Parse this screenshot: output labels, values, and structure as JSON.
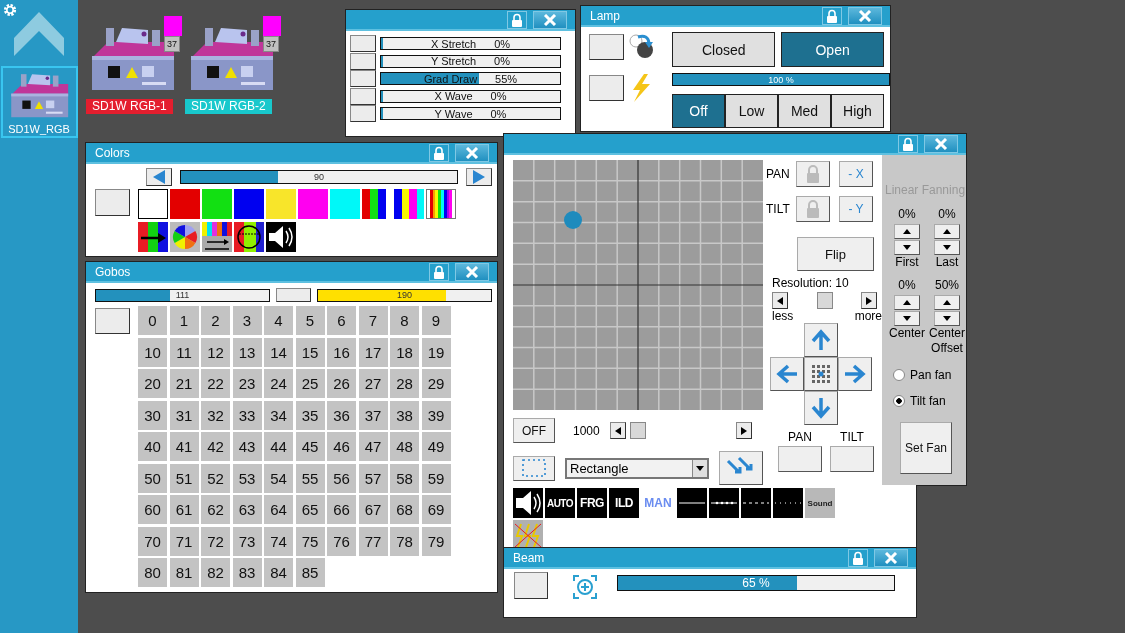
{
  "sidebar": {
    "device": {
      "label": "SD1W_RGB",
      "selected": true
    }
  },
  "fixtures": [
    {
      "label": "SD1W RGB-1",
      "color": "#e41e2e",
      "badge": "37"
    },
    {
      "label": "SD1W RGB-2",
      "color": "#18c8cc",
      "badge": "37"
    }
  ],
  "effects_window": {
    "sliders": [
      {
        "label": "X Stretch",
        "reading": "0%",
        "level": 0
      },
      {
        "label": "Y Stretch",
        "reading": "0%",
        "level": 0
      },
      {
        "label": "Grad Draw",
        "reading": "55%",
        "level": 0.55
      },
      {
        "label": "X Wave",
        "reading": "0%",
        "level": 0
      },
      {
        "label": "Y Wave",
        "reading": "0%",
        "level": 0
      }
    ]
  },
  "lamp_window": {
    "title": "Lamp",
    "shutter": [
      {
        "label": "Closed",
        "selected": false
      },
      {
        "label": "Open",
        "selected": true
      }
    ],
    "dimmer": {
      "reading": "100 %",
      "level": 1
    },
    "modes": [
      {
        "label": "Off",
        "selected": true
      },
      {
        "label": "Low",
        "selected": false
      },
      {
        "label": "Med",
        "selected": false
      },
      {
        "label": "High",
        "selected": false
      }
    ]
  },
  "colors_window": {
    "title": "Colors",
    "slider": {
      "reading": "90",
      "level": 0.35
    },
    "swatches": [
      {
        "kind": "solid",
        "color": "#ffffff",
        "selected": true
      },
      {
        "kind": "solid",
        "color": "#e30000",
        "selected": false
      },
      {
        "kind": "solid",
        "color": "#12e012",
        "selected": false
      },
      {
        "kind": "solid",
        "color": "#0000f0",
        "selected": false
      },
      {
        "kind": "solid",
        "color": "#f8e52a",
        "selected": false
      },
      {
        "kind": "solid",
        "color": "#ff00f0",
        "selected": false
      },
      {
        "kind": "solid",
        "color": "#00f8f8",
        "selected": false
      },
      {
        "kind": "rgb",
        "selected": false
      },
      {
        "kind": "bymc",
        "selected": false
      },
      {
        "kind": "rainbow",
        "selected": false
      }
    ]
  },
  "gobos_window": {
    "title": "Gobos",
    "rotation": {
      "reading": "111",
      "level": 0.43
    },
    "shake": {
      "reading": "190",
      "level": 0.74
    },
    "gobos": [
      "0",
      "1",
      "2",
      "3",
      "4",
      "5",
      "6",
      "7",
      "8",
      "9",
      "10",
      "11",
      "12",
      "13",
      "14",
      "15",
      "16",
      "17",
      "18",
      "19",
      "20",
      "21",
      "22",
      "23",
      "24",
      "25",
      "26",
      "27",
      "28",
      "29",
      "30",
      "31",
      "32",
      "33",
      "34",
      "35",
      "36",
      "37",
      "38",
      "39",
      "40",
      "41",
      "42",
      "43",
      "44",
      "45",
      "46",
      "47",
      "48",
      "49",
      "50",
      "51",
      "52",
      "53",
      "54",
      "55",
      "56",
      "57",
      "58",
      "59",
      "60",
      "61",
      "62",
      "63",
      "64",
      "65",
      "66",
      "67",
      "68",
      "69",
      "70",
      "71",
      "72",
      "73",
      "74",
      "75",
      "76",
      "77",
      "78",
      "79",
      "80",
      "81",
      "82",
      "83",
      "84",
      "85"
    ]
  },
  "pantilt_window": {
    "position": {
      "pan": {
        "level": 0.24
      },
      "tilt": {
        "level": 0.24
      }
    },
    "pan_label": "PAN",
    "tilt_label": "TILT",
    "invert_pan": "- X",
    "invert_tilt": "- Y",
    "flip": "Flip",
    "resolution": {
      "label": "Resolution: 10",
      "level": 0.5,
      "less": "less",
      "more": "more"
    },
    "off": "OFF",
    "speed": {
      "reading": "1000",
      "level": 0.05
    },
    "shape": "Rectangle",
    "pan_field_label": "PAN",
    "tilt_field_label": "TILT",
    "fanning": {
      "title": "Linear Fanning",
      "params": [
        {
          "reading": "0%",
          "label": "First"
        },
        {
          "reading": "0%",
          "label": "Last"
        },
        {
          "reading": "0%",
          "label": "Center"
        },
        {
          "reading": "50%",
          "label": "Center Offset"
        }
      ],
      "modes": [
        {
          "label": "Pan fan",
          "selected": false
        },
        {
          "label": "Tilt fan",
          "selected": true
        }
      ],
      "set_fan": "Set Fan"
    }
  },
  "pattern_strip": {
    "buttons": [
      {
        "kind": "speaker"
      },
      {
        "kind": "text",
        "label": "AUTO"
      },
      {
        "kind": "text",
        "label": "FRG"
      },
      {
        "kind": "text",
        "label": "ILD"
      },
      {
        "kind": "link",
        "label": "MAN"
      },
      {
        "kind": "solidline"
      },
      {
        "kind": "beadedline"
      },
      {
        "kind": "dashedline"
      },
      {
        "kind": "dottedline"
      },
      {
        "kind": "sound",
        "label": "Sound"
      },
      {
        "kind": "nosound"
      }
    ]
  },
  "beam_window": {
    "title": "Beam",
    "reading": "65 %",
    "level": 0.65
  }
}
